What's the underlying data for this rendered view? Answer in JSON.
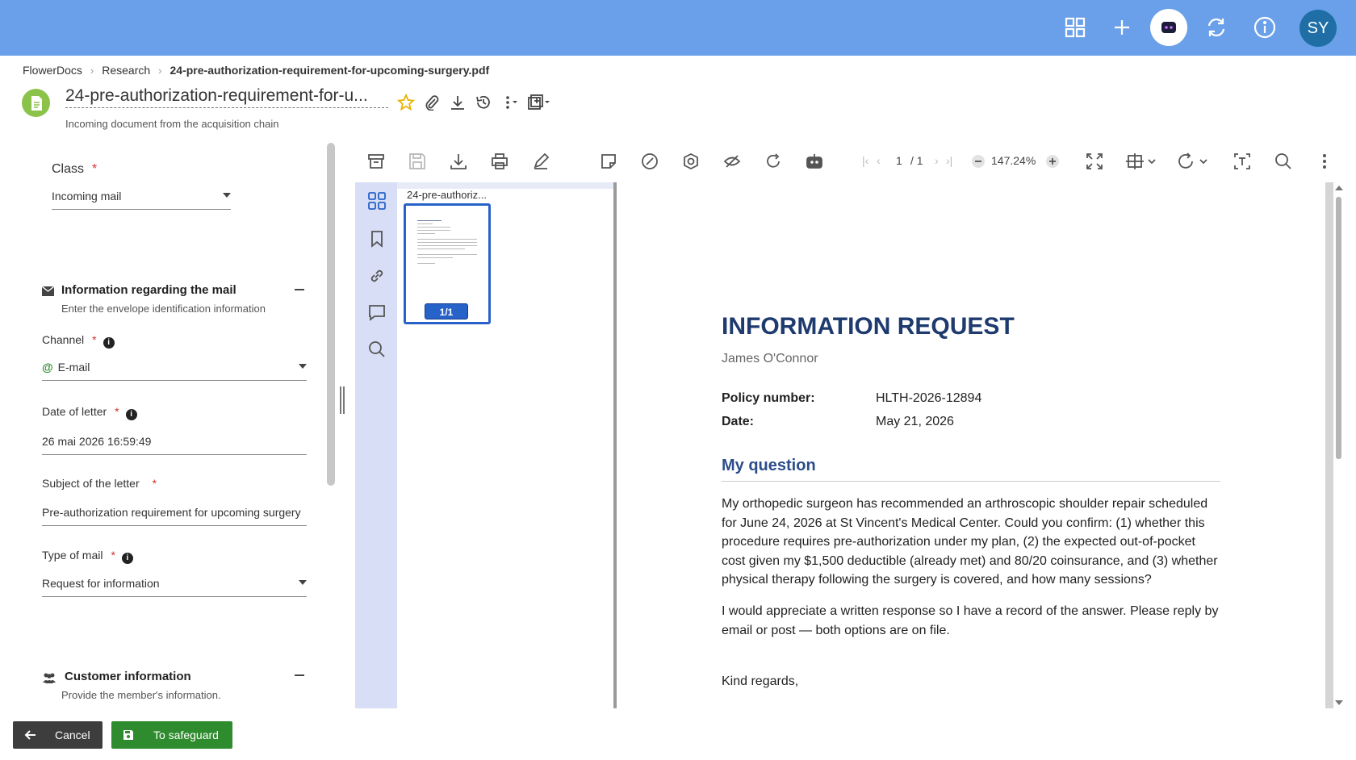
{
  "topbar": {
    "icons": [
      "apps-grid-icon",
      "plus-icon",
      "ai-assistant-icon",
      "refresh-icon",
      "info-icon"
    ],
    "user_initials": "SY",
    "colors": {
      "background": "#6aa0ea",
      "avatar": "#1f6fa6"
    }
  },
  "breadcrumb": {
    "items": [
      "FlowerDocs",
      "Research",
      "24-pre-authorization-requirement-for-upcoming-surgery.pdf"
    ],
    "separator": "›"
  },
  "document": {
    "title": "24-pre-authorization-requirement-for-u...",
    "subtitle": "Incoming document from the acquisition chain",
    "icon": "document-icon"
  },
  "form": {
    "class": {
      "label": "Class",
      "required": "*",
      "value": "Incoming mail"
    },
    "mail_section": {
      "title": "Information regarding the mail",
      "subtitle": "Enter the envelope identification information",
      "collapse": "−",
      "fields": {
        "channel": {
          "label": "Channel",
          "required": "*",
          "value": "E-mail",
          "prefix": "@"
        },
        "date": {
          "label": "Date of letter",
          "required": "*",
          "value": "26 mai 2026 16:59:49"
        },
        "subject": {
          "label": "Subject of the letter",
          "required": "*",
          "value": "Pre-authorization requirement for upcoming surgery"
        },
        "type": {
          "label": "Type of mail",
          "required": "*",
          "value": "Request for information"
        }
      }
    },
    "customer_section": {
      "title": "Customer information",
      "subtitle": "Provide the member's information.",
      "collapse": "−"
    }
  },
  "buttons": {
    "cancel": "Cancel",
    "save": "To safeguard"
  },
  "viewer": {
    "page_current": "1",
    "page_total": "/ 1",
    "zoom": "147.24%",
    "thumb_label": "24-pre-authoriz...",
    "thumb_page": "1/1"
  },
  "pdf": {
    "title": "INFORMATION REQUEST",
    "author": "James O'Connor",
    "policy_label": "Policy number:",
    "policy_value": "HLTH-2026-12894",
    "date_label": "Date:",
    "date_value": "May 21, 2026",
    "heading": "My question",
    "para1": "My orthopedic surgeon has recommended an arthroscopic shoulder repair scheduled for June 24, 2026 at St Vincent's Medical Center. Could you confirm: (1) whether this procedure requires pre-authorization under my plan, (2) the expected out-of-pocket cost given my $1,500 deductible (already met) and 80/20 coinsurance, and (3) whether physical therapy following the surgery is covered, and how many sessions?",
    "para2": "I would appreciate a written response so I have a record of the answer. Please reply by email or post — both options are on file.",
    "closing": "Kind regards,"
  }
}
